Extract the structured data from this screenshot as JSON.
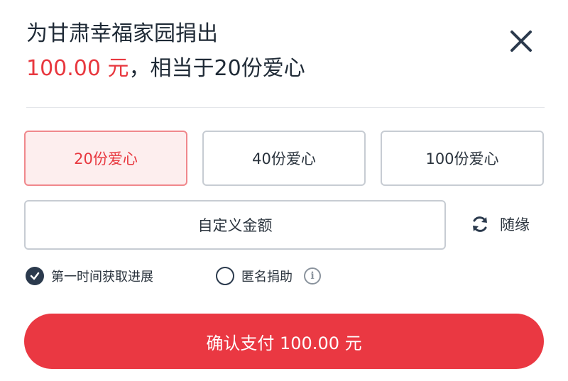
{
  "header": {
    "title": "为甘肃幸福家园捐出",
    "amount": "100.00 元",
    "equivalent": "，相当于20份爱心"
  },
  "icons": {
    "close": "close-icon",
    "refresh": "refresh-icon",
    "check": "checkmark-icon",
    "info": "info-icon"
  },
  "options": [
    {
      "label": "20份爱心",
      "selected": true
    },
    {
      "label": "40份爱心",
      "selected": false
    },
    {
      "label": "100份爱心",
      "selected": false
    }
  ],
  "custom_amount": {
    "label": "自定义金额"
  },
  "random": {
    "label": "随缘"
  },
  "checkboxes": [
    {
      "label": "第一时间获取进展",
      "checked": true
    },
    {
      "label": "匿名捐助",
      "checked": false
    }
  ],
  "pay_button": {
    "label": "确认支付 100.00 元"
  },
  "colors": {
    "accent": "#e8383f",
    "button": "#ea3842",
    "dark": "#2b3a4d"
  }
}
